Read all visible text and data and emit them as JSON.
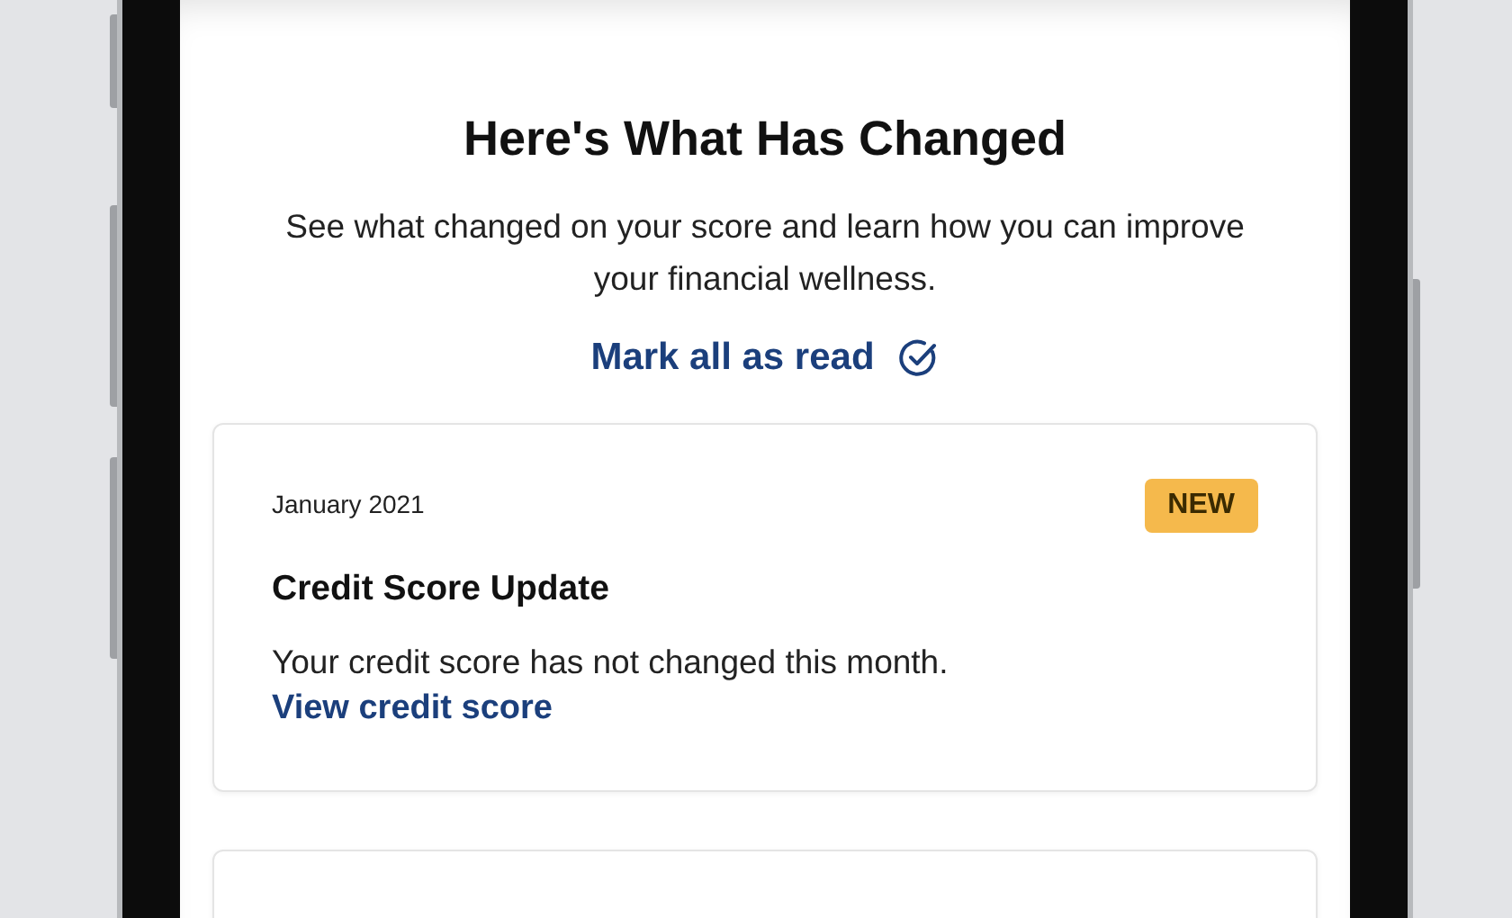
{
  "header": {
    "title": "Here's What Has Changed",
    "subtitle": "See what changed on your score and learn how you can improve your financial wellness."
  },
  "mark_all_link": {
    "label": "Mark all as read"
  },
  "cards": [
    {
      "date": "January 2021",
      "badge": "NEW",
      "title": "Credit Score Update",
      "body": "Your credit score has not changed this month.",
      "link": "View credit score"
    }
  ]
}
